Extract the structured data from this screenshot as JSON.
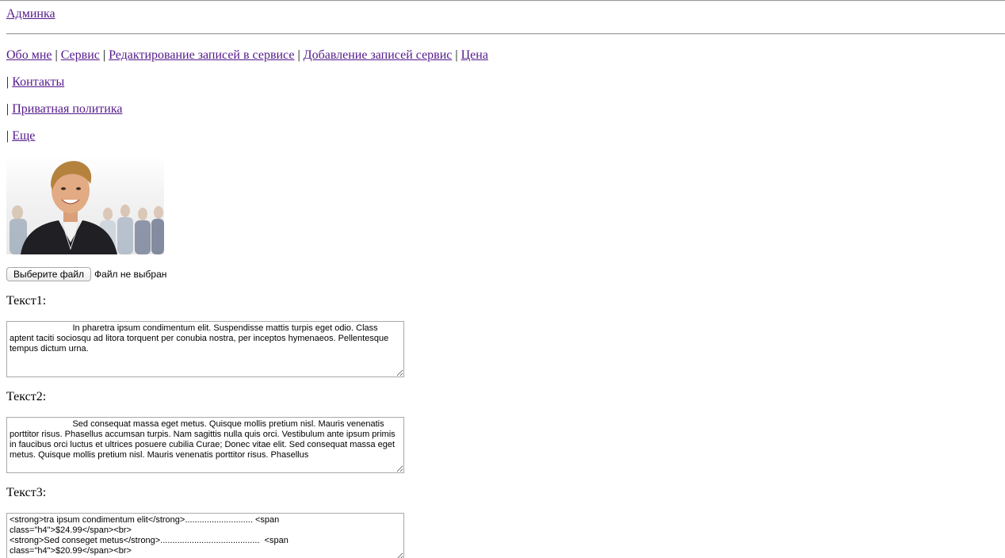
{
  "header": {
    "admin_link": "Админка"
  },
  "nav": {
    "about": "Обо мне",
    "service": "Сервис",
    "edit_records": "Редактирование записей в сервисе",
    "add_records": "Добавление записей сервис",
    "price": "Цена",
    "contacts": "Контакты",
    "privacy": "Приватная политика",
    "more": "Еще",
    "separator": "|"
  },
  "file_input": {
    "button_label": "Выберите файл",
    "status": "Файл не выбран"
  },
  "fields": [
    {
      "label": "Текст1:",
      "value": "                          In pharetra ipsum condimentum elit. Suspendisse mattis turpis eget odio. Class aptent taciti sociosqu ad litora torquent per conubia nostra, per inceptos hymenaeos. Pellentesque tempus dictum urna."
    },
    {
      "label": "Текст2:",
      "value": "                          Sed consequat massa eget metus. Quisque mollis pretium nisl. Mauris venenatis porttitor risus. Phasellus accumsan turpis. Nam sagittis nulla quis orci. Vestibulum ante ipsum primis in faucibus orci luctus et ultrices posuere cubilia Curae; Donec vitae elit. Sed consequat massa eget metus. Quisque mollis pretium nisl. Mauris venenatis porttitor risus. Phasellus"
    },
    {
      "label": "Текст3:",
      "value": "<strong>tra ipsum condimentum elit</strong>............................ <span\nclass=\"h4\">$24.99</span><br>\n<strong>Sed conseget metus</strong>.........................................  <span\nclass=\"h4\">$20.99</span><br>"
    }
  ]
}
